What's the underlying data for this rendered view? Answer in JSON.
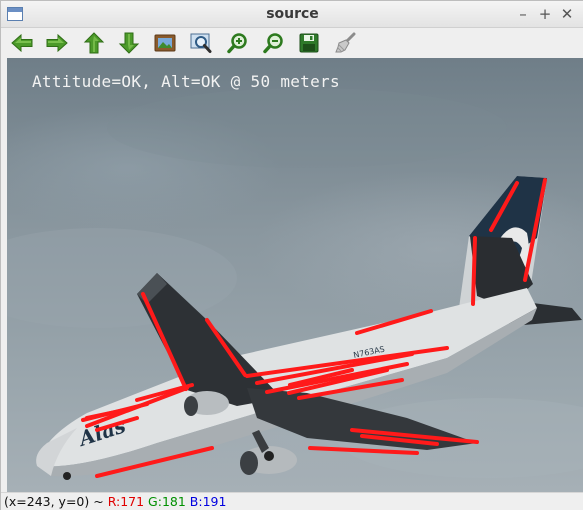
{
  "window": {
    "title": "source"
  },
  "window_controls": {
    "minimize": "–",
    "maximize": "+",
    "close": "✕"
  },
  "toolbar": {
    "buttons": [
      {
        "name": "pan-left",
        "icon": "arrow-left-icon"
      },
      {
        "name": "pan-right",
        "icon": "arrow-right-icon"
      },
      {
        "name": "pan-up",
        "icon": "arrow-up-icon"
      },
      {
        "name": "pan-down",
        "icon": "arrow-down-icon"
      },
      {
        "name": "zoom-fit",
        "icon": "image-icon"
      },
      {
        "name": "zoom-actual",
        "icon": "zoom-region-icon"
      },
      {
        "name": "zoom-in",
        "icon": "zoom-in-icon"
      },
      {
        "name": "zoom-out",
        "icon": "zoom-out-icon"
      },
      {
        "name": "save",
        "icon": "save-icon"
      },
      {
        "name": "properties",
        "icon": "brush-icon"
      }
    ]
  },
  "image": {
    "overlay_text": "Attitude=OK, Alt=OK @ 50 meters",
    "tail_registration": "N763AS"
  },
  "status": {
    "coords": "(x=243, y=0) ~ ",
    "r": "R:171",
    "g": "G:181",
    "b": "B:191"
  },
  "colors": {
    "detection_lines": "#ff1a1a",
    "status_r": "#e00000",
    "status_g": "#009000",
    "status_b": "#0000e0"
  }
}
